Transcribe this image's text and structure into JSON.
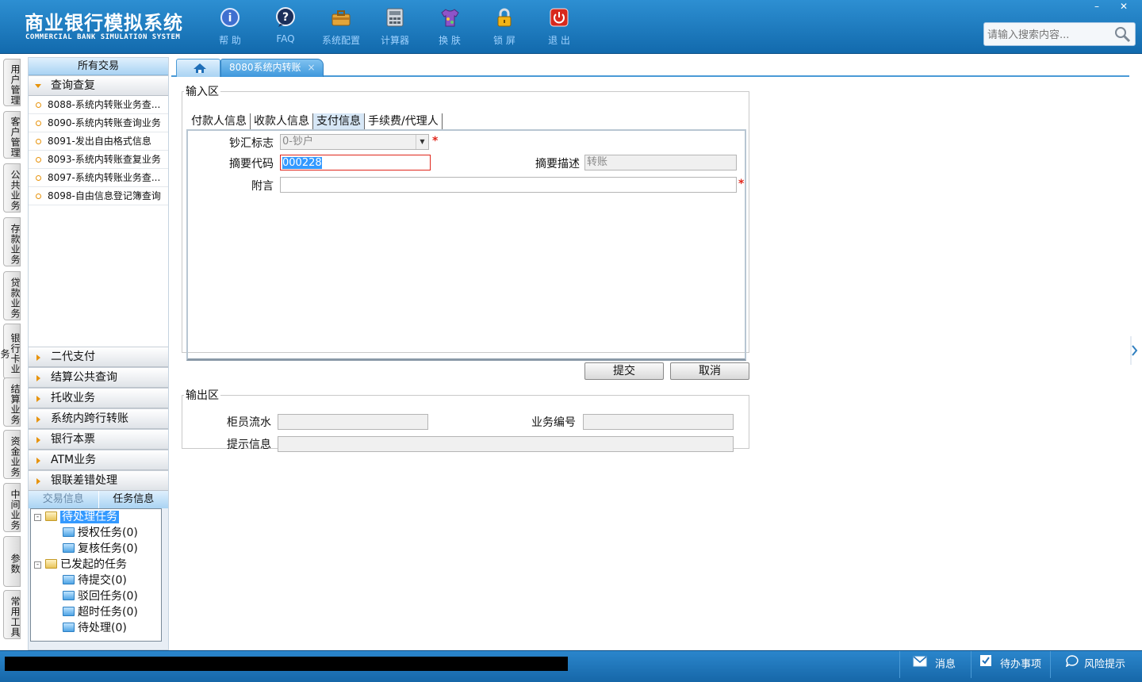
{
  "app": {
    "title_cn": "商业银行模拟系统",
    "title_en": "COMMERCIAL BANK SIMULATION SYSTEM"
  },
  "toolbar": [
    {
      "label": "帮 助",
      "icon": "help-icon"
    },
    {
      "label": "FAQ",
      "icon": "faq-icon"
    },
    {
      "label": "系统配置",
      "icon": "toolbox-icon"
    },
    {
      "label": "计算器",
      "icon": "calculator-icon"
    },
    {
      "label": "换 肤",
      "icon": "shirt-icon"
    },
    {
      "label": "锁 屏",
      "icon": "lock-icon"
    },
    {
      "label": "退 出",
      "icon": "power-icon"
    }
  ],
  "window_controls": {
    "minimize": "–",
    "close": "✕"
  },
  "search": {
    "placeholder": "请输入搜索内容..."
  },
  "vertical_tabs": [
    "用户管理",
    "客户管理",
    "公共业务",
    "存款业务",
    "贷款业务",
    "银行卡业务",
    "结算业务",
    "资金业务",
    "中间业务",
    "参数",
    "常用工具"
  ],
  "leftnav": {
    "header": "所有交易",
    "open_group": "查询查复",
    "items": [
      "8088-系统内转账业务查...",
      "8090-系统内转账查询业务",
      "8091-发出自由格式信息",
      "8093-系统内转账查复业务",
      "8097-系统内转账业务查...",
      "8098-自由信息登记簿查询"
    ],
    "groups": [
      "二代支付",
      "结算公共查询",
      "托收业务",
      "系统内跨行转账",
      "银行本票",
      "ATM业务",
      "银联差错处理"
    ]
  },
  "panel_tabs": {
    "tx_info": "交易信息",
    "task_info": "任务信息"
  },
  "tasks": {
    "pending": "待处理任务",
    "pending_children": [
      "授权任务(0)",
      "复核任务(0)"
    ],
    "initiated": "已发起的任务",
    "initiated_children": [
      "待提交(0)",
      "驳回任务(0)",
      "超时任务(0)",
      "待处理(0)"
    ]
  },
  "main_tabs": {
    "active": "8080系统内转账",
    "close": "×"
  },
  "input_area": {
    "legend": "输入区",
    "tabs": [
      "付款人信息",
      "收款人信息",
      "支付信息",
      "手续费/代理人"
    ],
    "active_tab": "支付信息",
    "currency_flag": {
      "label": "钞汇标志",
      "value": "0-钞户"
    },
    "summary_code": {
      "label": "摘要代码",
      "value": "000228"
    },
    "summary_desc": {
      "label": "摘要描述",
      "value": "转账"
    },
    "postscript": {
      "label": "附言",
      "value": ""
    },
    "required_mark": "*"
  },
  "buttons": {
    "submit": "提交",
    "cancel": "取消"
  },
  "output_area": {
    "legend": "输出区",
    "teller_serial": {
      "label": "柜员流水",
      "value": ""
    },
    "business_no": {
      "label": "业务编号",
      "value": ""
    },
    "prompt": {
      "label": "提示信息",
      "value": ""
    }
  },
  "statusbar": {
    "message": "消息",
    "todo": "待办事项",
    "risk": "风险提示"
  },
  "colors": {
    "header_blue": "#1f7cc0",
    "accent_red": "#e0261b",
    "selection_blue": "#3399ff"
  }
}
